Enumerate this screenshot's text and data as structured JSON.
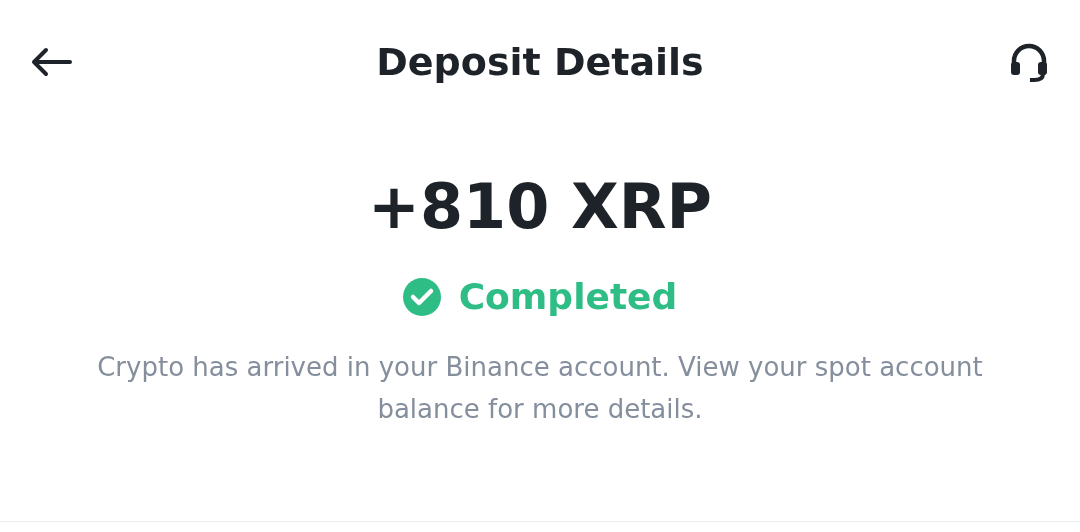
{
  "header": {
    "title": "Deposit Details"
  },
  "amount": "+810 XRP",
  "status": {
    "kind": "success",
    "label": "Completed"
  },
  "message": "Crypto has arrived in your Binance account. View your spot account balance for more details."
}
